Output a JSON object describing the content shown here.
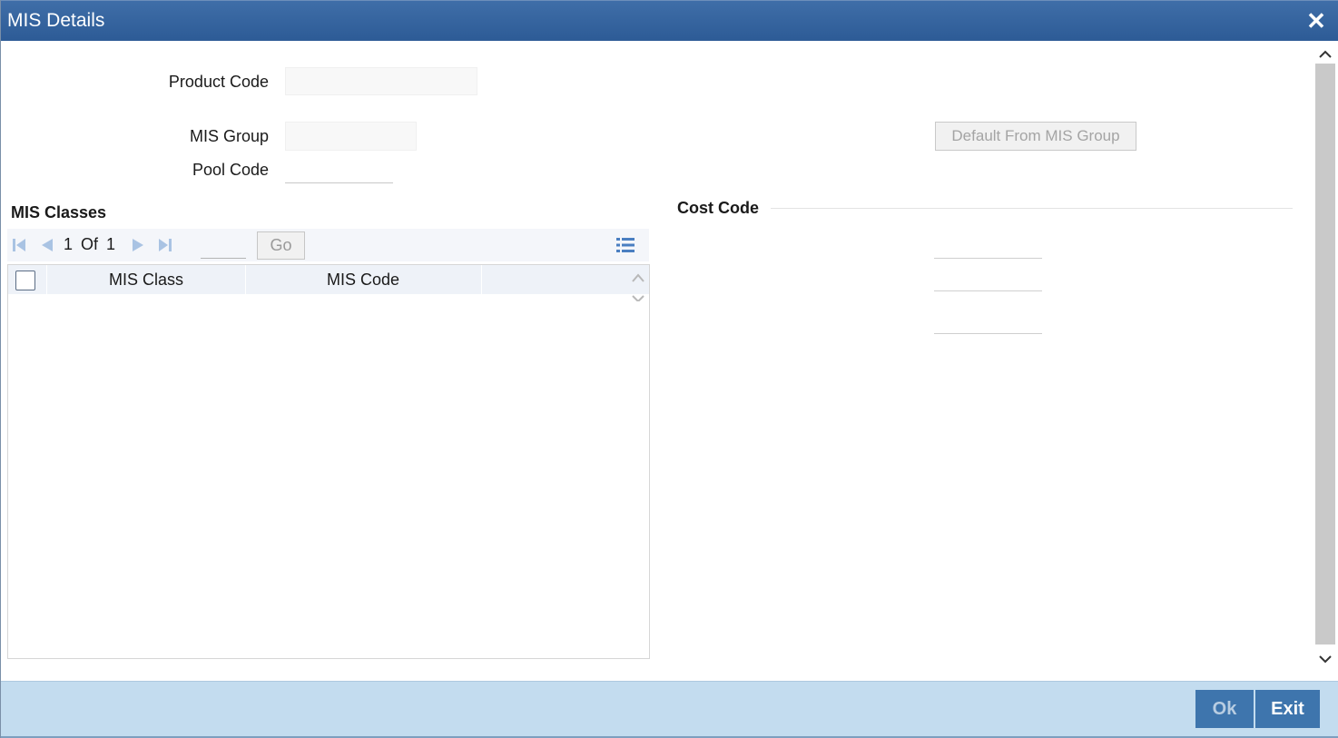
{
  "window": {
    "title": "MIS Details",
    "close_label": "✕"
  },
  "form": {
    "product_code_label": "Product Code",
    "product_code_value": "",
    "mis_group_label": "MIS Group",
    "mis_group_value": "",
    "pool_code_label": "Pool Code",
    "pool_code_value": "",
    "default_button": "Default From MIS Group"
  },
  "mis_classes": {
    "title": "MIS Classes",
    "pager": {
      "current": "1",
      "of_label": "Of",
      "total": "1",
      "go_label": "Go",
      "page_input": ""
    },
    "columns": [
      "MIS Class",
      "MIS Code"
    ],
    "rows": []
  },
  "cost_code": {
    "title": "Cost Code",
    "fields": [
      "",
      "",
      ""
    ]
  },
  "footer": {
    "ok_label": "Ok",
    "exit_label": "Exit"
  },
  "colors": {
    "titlebar": "#2d5b96",
    "footer": "#c3dcef",
    "button": "#3e75ad"
  }
}
